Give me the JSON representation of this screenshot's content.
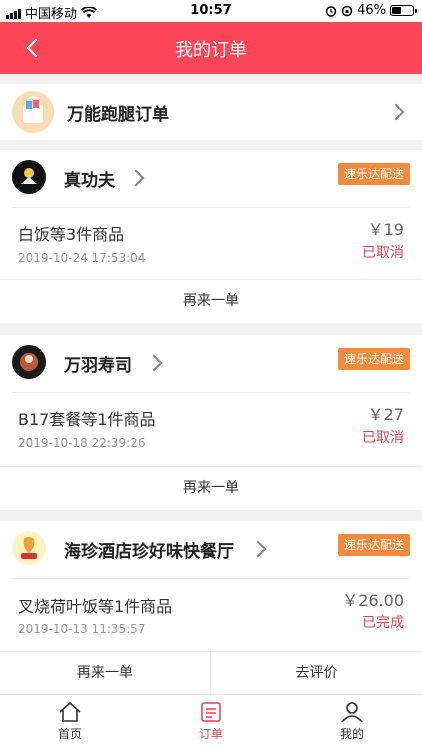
{
  "status_bar": {
    "carrier": "中国移动",
    "time": "10:57",
    "battery_percent": "46%",
    "battery_level": 0.46
  },
  "nav": {
    "title": "我的订单"
  },
  "errand": {
    "label": "万能跑腿订单"
  },
  "orders": [
    {
      "shop": "真功夫",
      "tag": "速乐达配送",
      "goods": "白饭等3件商品",
      "price": "￥19",
      "date": "2019-10-24 17:53:04",
      "status": "已取消",
      "actions": [
        "再来一单"
      ]
    },
    {
      "shop": "万羽寿司",
      "tag": "速乐达配送",
      "goods": "B17套餐等1件商品",
      "price": "￥27",
      "date": "2019-10-18 22:39:26",
      "status": "已取消",
      "actions": [
        "再来一单"
      ]
    },
    {
      "shop": "海珍酒店珍好味快餐厅",
      "tag": "速乐达配送",
      "goods": "叉烧荷叶饭等1件商品",
      "price": "￥26.00",
      "date": "2019-10-13 11:35:57",
      "status": "已完成",
      "actions": [
        "再来一单",
        "去评价"
      ]
    }
  ],
  "tabs": [
    {
      "label": "首页",
      "icon": "home-icon"
    },
    {
      "label": "订单",
      "icon": "order-icon"
    },
    {
      "label": "我的",
      "icon": "profile-icon"
    }
  ],
  "colors": {
    "brand": "#fd4558",
    "tag": "#f9893b",
    "status": "#e94556"
  }
}
